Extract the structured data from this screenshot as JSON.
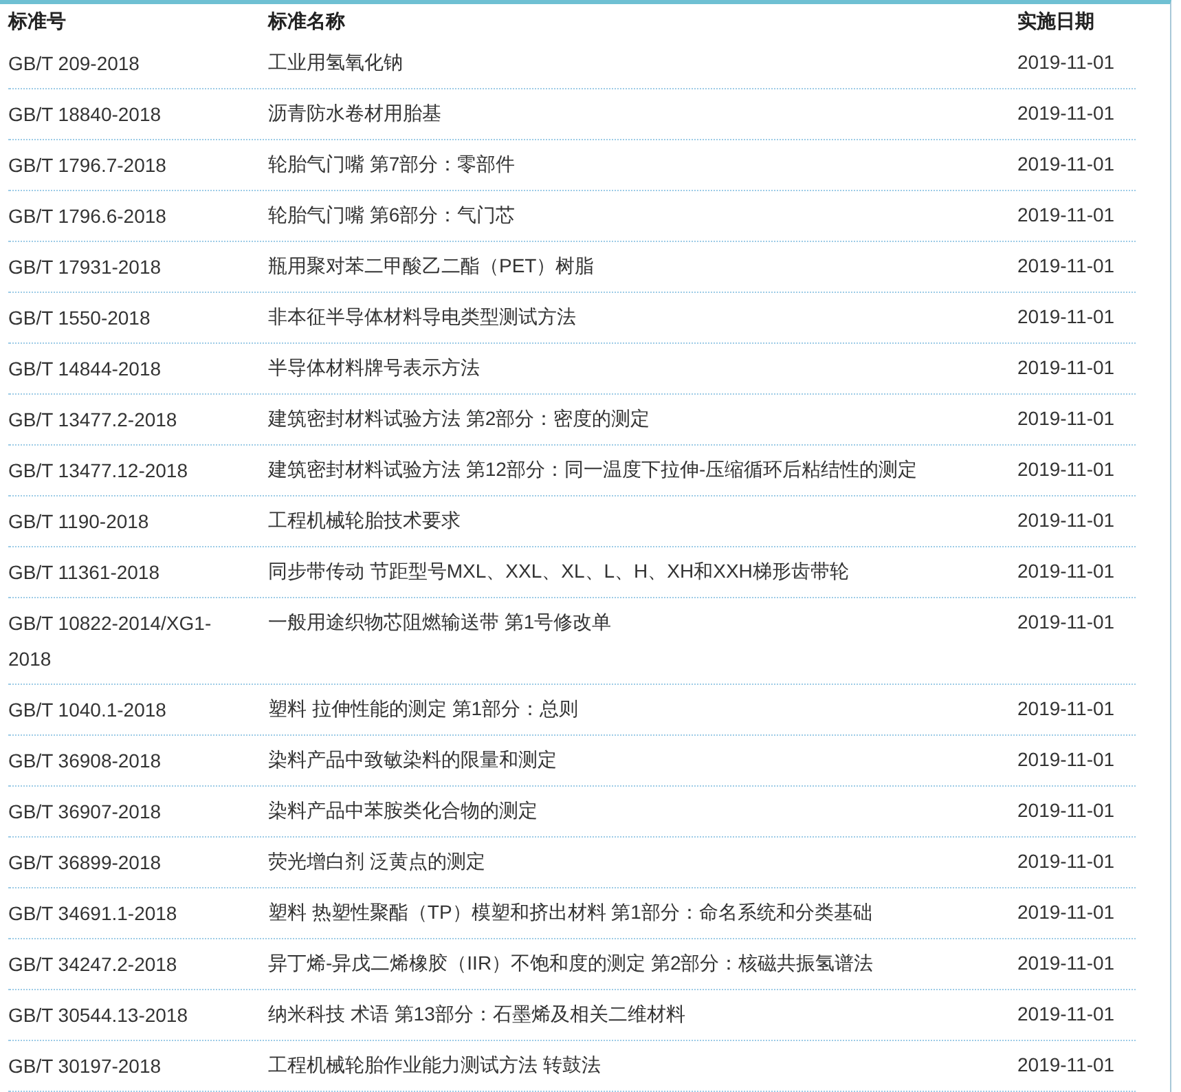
{
  "table": {
    "columns": [
      "标准号",
      "标准名称",
      "实施日期"
    ],
    "rows": [
      {
        "code": "GB/T 209-2018",
        "name": "工业用氢氧化钠",
        "date": "2019-11-01"
      },
      {
        "code": "GB/T 18840-2018",
        "name": "沥青防水卷材用胎基",
        "date": "2019-11-01"
      },
      {
        "code": "GB/T 1796.7-2018",
        "name": "轮胎气门嘴 第7部分：零部件",
        "date": "2019-11-01"
      },
      {
        "code": "GB/T 1796.6-2018",
        "name": "轮胎气门嘴 第6部分：气门芯",
        "date": "2019-11-01"
      },
      {
        "code": "GB/T 17931-2018",
        "name": "瓶用聚对苯二甲酸乙二酯（PET）树脂",
        "date": "2019-11-01"
      },
      {
        "code": "GB/T 1550-2018",
        "name": "非本征半导体材料导电类型测试方法",
        "date": "2019-11-01"
      },
      {
        "code": "GB/T 14844-2018",
        "name": "半导体材料牌号表示方法",
        "date": "2019-11-01"
      },
      {
        "code": "GB/T 13477.2-2018",
        "name": "建筑密封材料试验方法 第2部分：密度的测定",
        "date": "2019-11-01"
      },
      {
        "code": "GB/T 13477.12-2018",
        "name": "建筑密封材料试验方法 第12部分：同一温度下拉伸-压缩循环后粘结性的测定",
        "date": "2019-11-01"
      },
      {
        "code": "GB/T 1190-2018",
        "name": "工程机械轮胎技术要求",
        "date": "2019-11-01"
      },
      {
        "code": "GB/T 11361-2018",
        "name": "同步带传动 节距型号MXL、XXL、XL、L、H、XH和XXH梯形齿带轮",
        "date": "2019-11-01"
      },
      {
        "code": "GB/T 10822-2014/XG1-2018",
        "name": "一般用途织物芯阻燃输送带 第1号修改单",
        "date": "2019-11-01"
      },
      {
        "code": "GB/T 1040.1-2018",
        "name": "塑料 拉伸性能的测定 第1部分：总则",
        "date": "2019-11-01"
      },
      {
        "code": "GB/T 36908-2018",
        "name": "染料产品中致敏染料的限量和测定",
        "date": "2019-11-01"
      },
      {
        "code": "GB/T 36907-2018",
        "name": "染料产品中苯胺类化合物的测定",
        "date": "2019-11-01"
      },
      {
        "code": "GB/T 36899-2018",
        "name": "荧光增白剂 泛黄点的测定",
        "date": "2019-11-01"
      },
      {
        "code": "GB/T 34691.1-2018",
        "name": "塑料 热塑性聚酯（TP）模塑和挤出材料 第1部分：命名系统和分类基础",
        "date": "2019-11-01"
      },
      {
        "code": "GB/T 34247.2-2018",
        "name": "异丁烯-异戊二烯橡胶（IIR）不饱和度的测定 第2部分：核磁共振氢谱法",
        "date": "2019-11-01"
      },
      {
        "code": "GB/T 30544.13-2018",
        "name": "纳米科技 术语 第13部分：石墨烯及相关二维材料",
        "date": "2019-11-01"
      },
      {
        "code": "GB/T 30197-2018",
        "name": "工程机械轮胎作业能力测试方法 转鼓法",
        "date": "2019-11-01"
      }
    ]
  }
}
